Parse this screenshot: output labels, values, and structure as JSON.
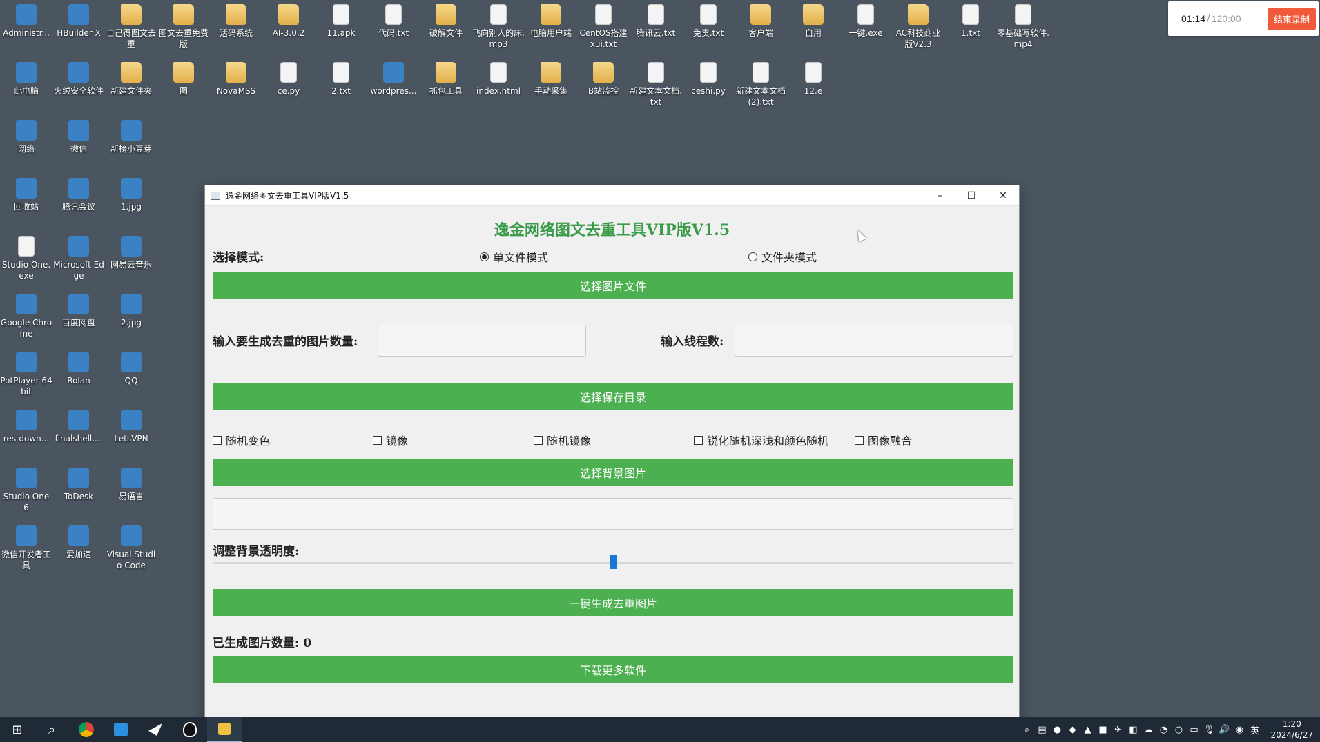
{
  "desktop": {
    "icons": [
      {
        "label": "Administr..."
      },
      {
        "label": "HBuilder X"
      },
      {
        "label": "自己得图文去重"
      },
      {
        "label": "图文去重免费版"
      },
      {
        "label": "活码系统"
      },
      {
        "label": "AI-3.0.2"
      },
      {
        "label": "11.apk"
      },
      {
        "label": "代码.txt"
      },
      {
        "label": "破解文件"
      },
      {
        "label": "飞向别人的床.mp3"
      },
      {
        "label": "电脑用户端"
      },
      {
        "label": "CentOS搭建xui.txt"
      },
      {
        "label": "腾讯云.txt"
      },
      {
        "label": "免责.txt"
      },
      {
        "label": "客户端"
      },
      {
        "label": "自用"
      },
      {
        "label": "一键.exe"
      },
      {
        "label": "AC科技商业版V2.3"
      },
      {
        "label": "1.txt"
      },
      {
        "label": "零基础写软件.mp4"
      },
      {
        "label": "此电脑"
      },
      {
        "label": "火绒安全软件"
      },
      {
        "label": "新建文件夹"
      },
      {
        "label": "图"
      },
      {
        "label": "NovaMSS"
      },
      {
        "label": "ce.py"
      },
      {
        "label": "2.txt"
      },
      {
        "label": "wordpres..."
      },
      {
        "label": "抓包工具"
      },
      {
        "label": "index.html"
      },
      {
        "label": "手动采集"
      },
      {
        "label": "B站监控"
      },
      {
        "label": "新建文本文档.txt"
      },
      {
        "label": "ceshi.py"
      },
      {
        "label": "新建文本文档 (2).txt"
      },
      {
        "label": "12.e"
      },
      {
        "label": "网络"
      },
      {
        "label": "微信"
      },
      {
        "label": "新榜小豆芽"
      },
      {
        "label": "回收站"
      },
      {
        "label": "腾讯会议"
      },
      {
        "label": "1.jpg"
      },
      {
        "label": "Studio One.exe"
      },
      {
        "label": "Microsoft Edge"
      },
      {
        "label": "网易云音乐"
      },
      {
        "label": "Google Chrome"
      },
      {
        "label": "百度网盘"
      },
      {
        "label": "2.jpg"
      },
      {
        "label": "PotPlayer 64 bit"
      },
      {
        "label": "Rolan"
      },
      {
        "label": "QQ"
      },
      {
        "label": "res-down..."
      },
      {
        "label": "finalshell...."
      },
      {
        "label": "LetsVPN"
      },
      {
        "label": "Studio One 6"
      },
      {
        "label": "ToDesk"
      },
      {
        "label": "易语言"
      },
      {
        "label": "微信开发者工具"
      },
      {
        "label": "爱加速"
      },
      {
        "label": "Visual Studio Code"
      }
    ]
  },
  "recorder": {
    "elapsed": "01:14",
    "separator": "/",
    "total": "120:00",
    "stop_label": "结束录制"
  },
  "window": {
    "title": "逸金网络图文去重工具VIP版V1.5",
    "minimize": "–",
    "maximize": "☐",
    "close": "✕"
  },
  "app": {
    "heading": "逸金网络图文去重工具VIP版V1.5",
    "mode_label": "选择模式:",
    "mode_single": "单文件模式",
    "mode_folder": "文件夹模式",
    "select_image_btn": "选择图片文件",
    "count_label": "输入要生成去重的图片数量:",
    "count_value": "",
    "thread_label": "输入线程数:",
    "thread_value": "",
    "select_dir_btn": "选择保存目录",
    "options": {
      "random_color": "随机变色",
      "mirror": "镜像",
      "random_mirror": "随机镜像",
      "sharpen": "锐化随机深浅和颜色随机",
      "blend": "图像融合"
    },
    "select_bg_btn": "选择背景图片",
    "bg_path_value": "",
    "opacity_label": "调整背景透明度:",
    "opacity_value": 0.5,
    "generate_btn": "一键生成去重图片",
    "generated_label": "已生成图片数量: 0",
    "download_btn": "下载更多软件"
  },
  "taskbar": {
    "start": "⊞",
    "search": "⌕",
    "ime": "英",
    "time": "1:20",
    "date": "2024/6/27"
  }
}
